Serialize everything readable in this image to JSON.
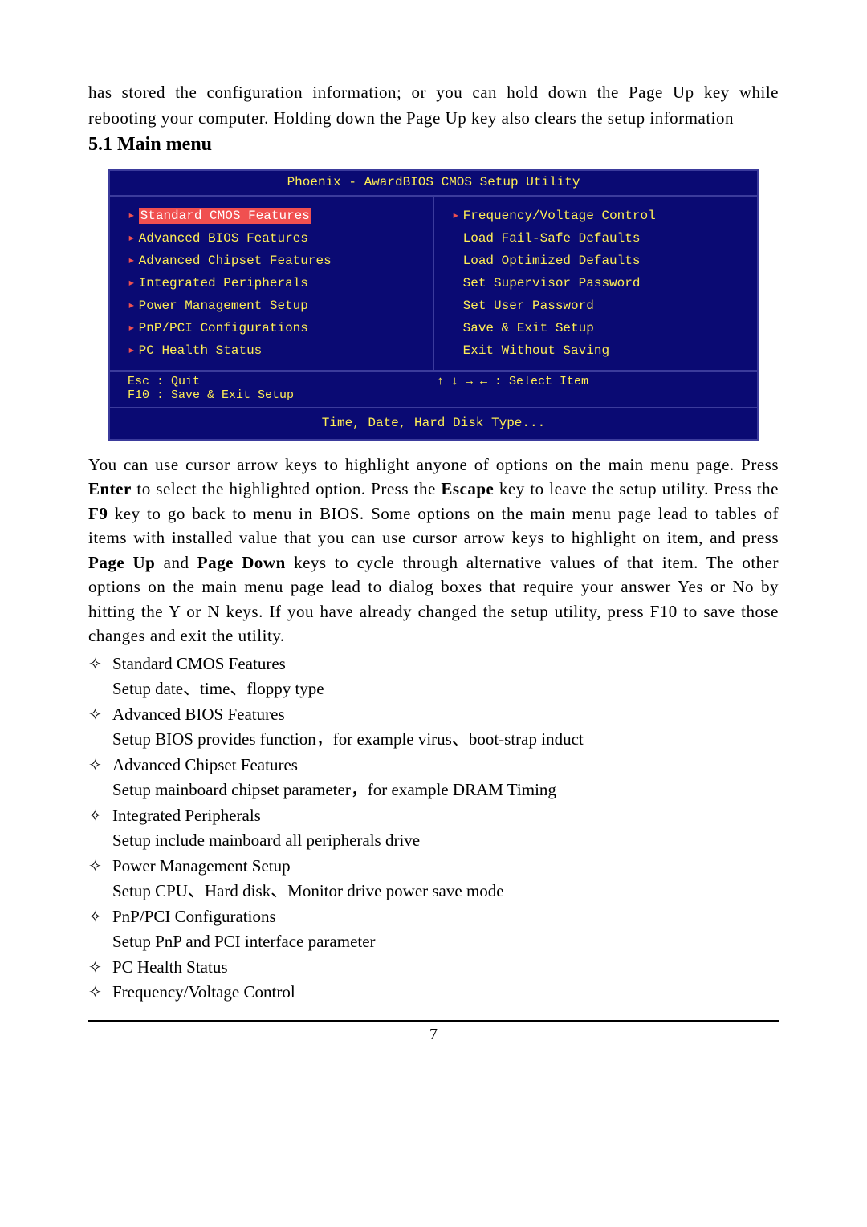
{
  "intro": "has stored the configuration information; or you can hold down the Page Up key while rebooting your computer. Holding down the Page Up key also clears the setup information",
  "section": {
    "number": "5.1",
    "title": "Main menu"
  },
  "bios": {
    "title": "Phoenix - AwardBIOS CMOS Setup Utility",
    "left": [
      {
        "label": "Standard CMOS Features",
        "caret": true,
        "selected": true
      },
      {
        "label": "Advanced BIOS Features",
        "caret": true
      },
      {
        "label": "Advanced Chipset Features",
        "caret": true
      },
      {
        "label": "Integrated Peripherals",
        "caret": true
      },
      {
        "label": "Power Management Setup",
        "caret": true
      },
      {
        "label": "PnP/PCI Configurations",
        "caret": true
      },
      {
        "label": "PC Health Status",
        "caret": true
      }
    ],
    "right": [
      {
        "label": "Frequency/Voltage Control",
        "caret": true
      },
      {
        "label": "Load Fail-Safe Defaults",
        "caret": false
      },
      {
        "label": "Load Optimized Defaults",
        "caret": false
      },
      {
        "label": "Set Supervisor Password",
        "caret": false
      },
      {
        "label": "Set User Password",
        "caret": false
      },
      {
        "label": "Save & Exit Setup",
        "caret": false
      },
      {
        "label": "Exit Without Saving",
        "caret": false
      }
    ],
    "footer": {
      "esc": "Esc : Quit",
      "f10": "F10 : Save & Exit Setup",
      "arrows": "↑ ↓ → ←   : Select Item"
    },
    "help": "Time, Date, Hard Disk Type..."
  },
  "para": {
    "t1": "You can use cursor arrow keys to highlight anyone of options on the main menu page. Press ",
    "b1": "Enter",
    "t2": " to select the highlighted option. Press the ",
    "b2": "Escape",
    "t3": " key to leave the setup utility. Press the ",
    "b3": "F9",
    "t4": " key to go back to menu in BIOS. Some options on the main menu page lead to tables of items with installed value that you can use cursor arrow keys to highlight on item, and press ",
    "b4": "Page Up",
    "t5": " and ",
    "b5": "Page Down",
    "t6": " keys to cycle through alternative values of that item. The other options on the main menu page lead to dialog boxes that require your answer Yes or No by hitting the Y or N keys. If you have already changed the setup utility, press F10 to save those changes and exit the utility."
  },
  "bullets": [
    {
      "title": "Standard CMOS Features",
      "desc": "Setup date、time、floppy type"
    },
    {
      "title": "Advanced BIOS Features",
      "desc": "Setup BIOS provides function，for example virus、boot-strap induct"
    },
    {
      "title": "Advanced Chipset Features",
      "desc": "Setup mainboard chipset parameter，for example DRAM Timing"
    },
    {
      "title": "Integrated Peripherals",
      "desc": "Setup include mainboard all peripherals drive"
    },
    {
      "title": "Power Management Setup",
      "desc": "Setup CPU、Hard disk、Monitor drive power save mode"
    },
    {
      "title": "PnP/PCI Configurations",
      "desc": "Setup PnP and PCI interface parameter"
    },
    {
      "title": "PC Health Status",
      "desc": ""
    },
    {
      "title": "Frequency/Voltage Control",
      "desc": ""
    }
  ],
  "diamond": "✧",
  "page_number": "7"
}
